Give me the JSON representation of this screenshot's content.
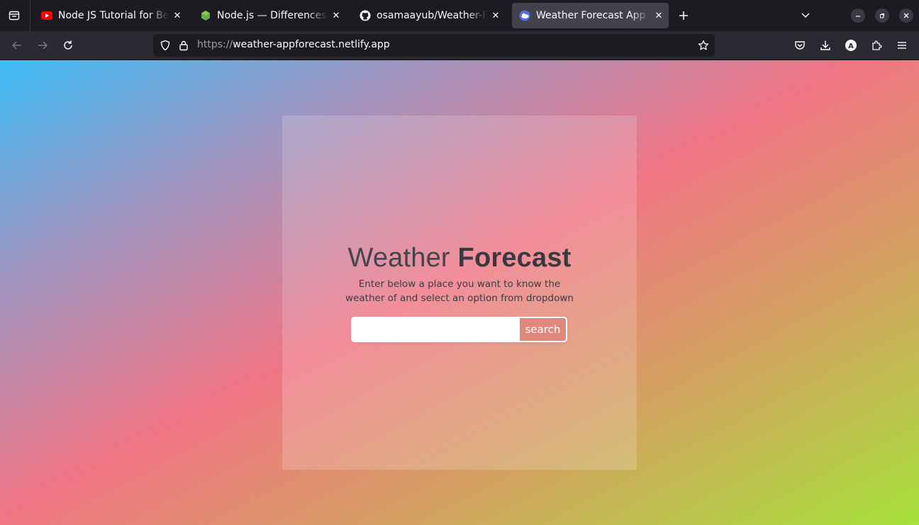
{
  "browser": {
    "tabs": [
      {
        "title": "Node JS Tutorial for Beginners",
        "favicon": "youtube-icon",
        "active": false
      },
      {
        "title": "Node.js — Differences between",
        "favicon": "nodejs-icon",
        "active": false
      },
      {
        "title": "osamaayub/Weather-Forecast",
        "favicon": "github-icon",
        "active": false
      },
      {
        "title": "Weather Forecast App made",
        "favicon": "weather-app-icon",
        "active": true
      }
    ],
    "address": {
      "scheme": "https://",
      "host": "weather-appforecast.netlify.app"
    }
  },
  "page": {
    "heading_light": "Weather",
    "heading_bold": "Forecast",
    "subtitle": "Enter below a place you want to know the weather of and select an option from dropdown",
    "search": {
      "value": "",
      "placeholder": "",
      "button_label": "search"
    }
  },
  "colors": {
    "gradient": [
      "#3dbdf7",
      "#9a96c2",
      "#f07584",
      "#d59f62",
      "#a6e23a"
    ],
    "search_button": "#de8278",
    "tab_active": "#42414d"
  }
}
